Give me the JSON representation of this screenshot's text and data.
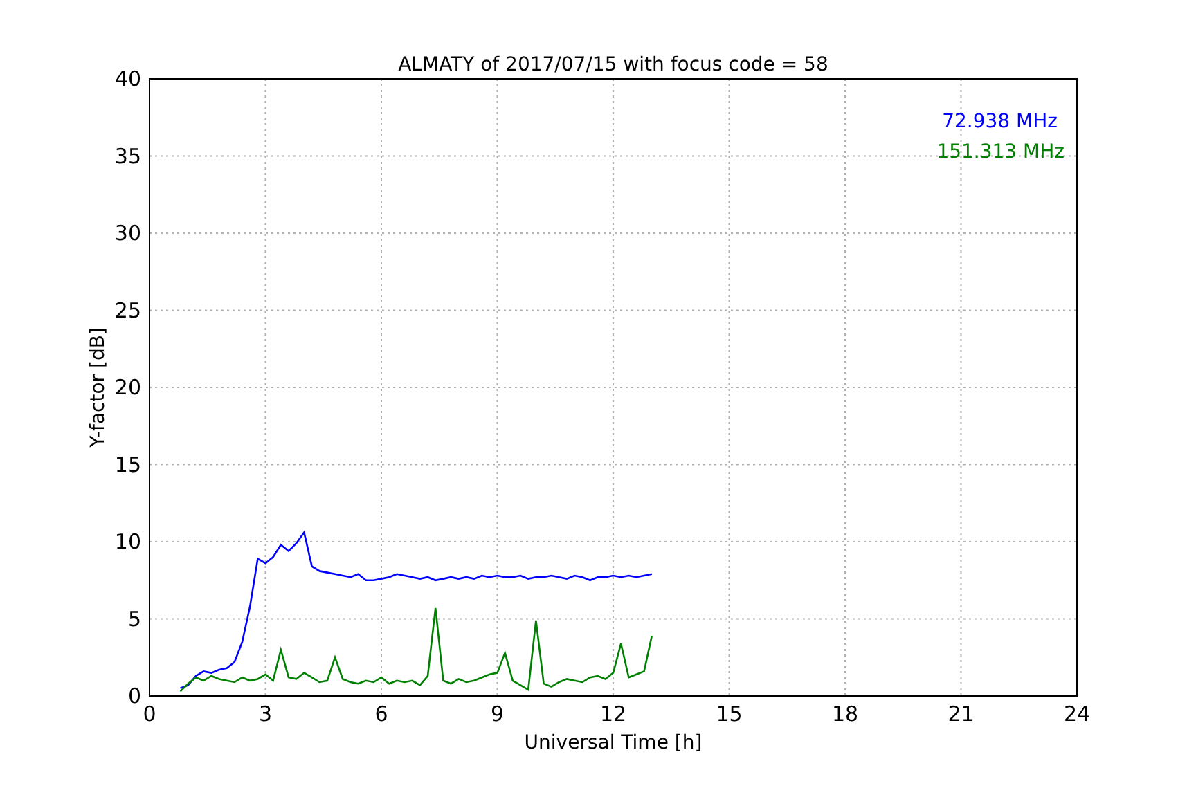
{
  "figure": {
    "chart_data": {
      "type": "line",
      "title": "ALMATY of 2017/07/15 with focus code = 58",
      "xlabel": "Universal Time [h]",
      "ylabel": "Y-factor [dB]",
      "grid": true,
      "xlim": [
        0,
        24
      ],
      "ylim": [
        0,
        40
      ],
      "xticks": [
        0,
        3,
        6,
        9,
        12,
        15,
        18,
        21,
        24
      ],
      "yticks": [
        0,
        5,
        10,
        15,
        20,
        25,
        30,
        35,
        40
      ],
      "x": [
        0.8,
        1.0,
        1.2,
        1.4,
        1.6,
        1.8,
        2.0,
        2.2,
        2.4,
        2.6,
        2.8,
        3.0,
        3.2,
        3.4,
        3.6,
        3.8,
        4.0,
        4.2,
        4.4,
        4.6,
        4.8,
        5.0,
        5.2,
        5.4,
        5.6,
        5.8,
        6.0,
        6.2,
        6.4,
        6.6,
        6.8,
        7.0,
        7.2,
        7.4,
        7.6,
        7.8,
        8.0,
        8.2,
        8.4,
        8.6,
        8.8,
        9.0,
        9.2,
        9.4,
        9.6,
        9.8,
        10.0,
        10.2,
        10.4,
        10.6,
        10.8,
        11.0,
        11.2,
        11.4,
        11.6,
        11.8,
        12.0,
        12.2,
        12.4,
        12.6,
        12.8,
        13.0
      ],
      "series": [
        {
          "name": "72.938 MHz",
          "color": "#0000ff",
          "values": [
            0.5,
            0.7,
            1.3,
            1.6,
            1.5,
            1.7,
            1.8,
            2.2,
            3.5,
            5.8,
            8.9,
            8.6,
            9.0,
            9.8,
            9.4,
            9.9,
            10.6,
            8.4,
            8.1,
            8.0,
            7.9,
            7.8,
            7.7,
            7.9,
            7.5,
            7.5,
            7.6,
            7.7,
            7.9,
            7.8,
            7.7,
            7.6,
            7.7,
            7.5,
            7.6,
            7.7,
            7.6,
            7.7,
            7.6,
            7.8,
            7.7,
            7.8,
            7.7,
            7.7,
            7.8,
            7.6,
            7.7,
            7.7,
            7.8,
            7.7,
            7.6,
            7.8,
            7.7,
            7.5,
            7.7,
            7.7,
            7.8,
            7.7,
            7.8,
            7.7,
            7.8,
            7.9
          ]
        },
        {
          "name": "151.313 MHz",
          "color": "#008000",
          "values": [
            0.3,
            0.8,
            1.2,
            1.0,
            1.3,
            1.1,
            1.0,
            0.9,
            1.2,
            1.0,
            1.1,
            1.4,
            1.0,
            3.0,
            1.2,
            1.1,
            1.5,
            1.2,
            0.9,
            1.0,
            2.5,
            1.1,
            0.9,
            0.8,
            1.0,
            0.9,
            1.2,
            0.8,
            1.0,
            0.9,
            1.0,
            0.7,
            1.3,
            5.7,
            1.0,
            0.8,
            1.1,
            0.9,
            1.0,
            1.2,
            1.4,
            1.5,
            2.8,
            1.0,
            0.7,
            0.4,
            4.9,
            0.8,
            0.6,
            0.9,
            1.1,
            1.0,
            0.9,
            1.2,
            1.3,
            1.1,
            1.5,
            3.4,
            1.2,
            1.4,
            1.6,
            3.9
          ]
        }
      ]
    }
  }
}
